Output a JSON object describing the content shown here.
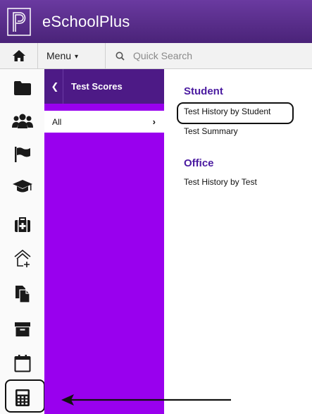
{
  "header": {
    "app_title": "eSchoolPlus",
    "logo_icon": "pearson-p-logo"
  },
  "toolbar": {
    "home_icon": "home-icon",
    "menu_label": "Menu",
    "search_placeholder": "Quick Search"
  },
  "rail": {
    "icons": [
      "folder-icon",
      "users-icon",
      "flag-icon",
      "graduation-cap-icon",
      "medical-kit-icon",
      "home-plus-icon",
      "documents-icon",
      "archive-box-icon",
      "calendar-icon",
      "calculator-icon"
    ],
    "highlighted": "calculator-icon"
  },
  "subpanel": {
    "title": "Test Scores",
    "items": [
      {
        "label": "All"
      }
    ]
  },
  "main": {
    "sections": [
      {
        "title": "Student",
        "links": [
          "Test History by Student",
          "Test Summary"
        ]
      },
      {
        "title": "Office",
        "links": [
          "Test History by Test"
        ]
      }
    ],
    "highlighted_link": "Test History by Student"
  },
  "colors": {
    "header": "#5a2d8c",
    "subpanel": "#9900ee",
    "subpanel_header": "#4d1a86",
    "section_title": "#4a1aa0"
  }
}
